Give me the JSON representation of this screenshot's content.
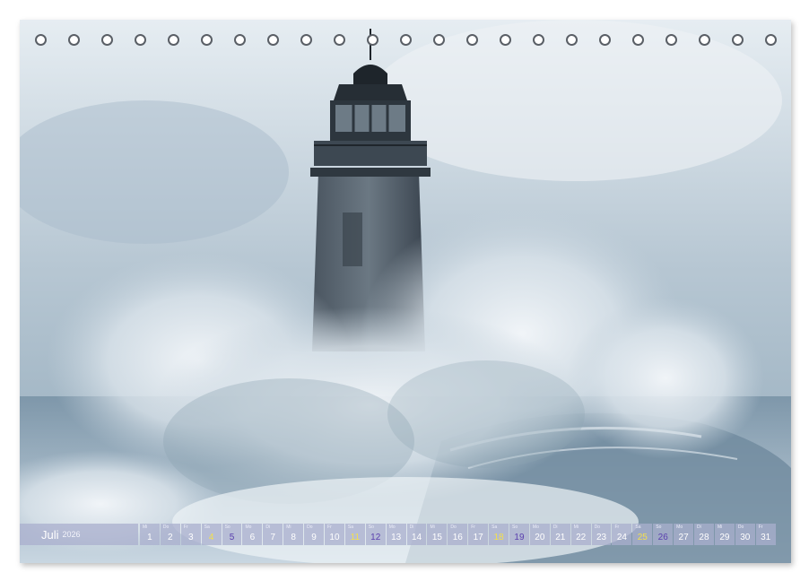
{
  "calendar": {
    "month": "Juli",
    "year": "2026",
    "days": [
      {
        "n": "1",
        "wd": "Mi",
        "type": "weekday"
      },
      {
        "n": "2",
        "wd": "Do",
        "type": "weekday"
      },
      {
        "n": "3",
        "wd": "Fr",
        "type": "weekday"
      },
      {
        "n": "4",
        "wd": "Sa",
        "type": "sat"
      },
      {
        "n": "5",
        "wd": "So",
        "type": "sun"
      },
      {
        "n": "6",
        "wd": "Mo",
        "type": "weekday"
      },
      {
        "n": "7",
        "wd": "Di",
        "type": "weekday"
      },
      {
        "n": "8",
        "wd": "Mi",
        "type": "weekday"
      },
      {
        "n": "9",
        "wd": "Do",
        "type": "weekday"
      },
      {
        "n": "10",
        "wd": "Fr",
        "type": "weekday"
      },
      {
        "n": "11",
        "wd": "Sa",
        "type": "sat"
      },
      {
        "n": "12",
        "wd": "So",
        "type": "sun"
      },
      {
        "n": "13",
        "wd": "Mo",
        "type": "weekday"
      },
      {
        "n": "14",
        "wd": "Di",
        "type": "weekday"
      },
      {
        "n": "15",
        "wd": "Mi",
        "type": "weekday"
      },
      {
        "n": "16",
        "wd": "Do",
        "type": "weekday"
      },
      {
        "n": "17",
        "wd": "Fr",
        "type": "weekday"
      },
      {
        "n": "18",
        "wd": "Sa",
        "type": "sat"
      },
      {
        "n": "19",
        "wd": "So",
        "type": "sun"
      },
      {
        "n": "20",
        "wd": "Mo",
        "type": "weekday"
      },
      {
        "n": "21",
        "wd": "Di",
        "type": "weekday"
      },
      {
        "n": "22",
        "wd": "Mi",
        "type": "weekday"
      },
      {
        "n": "23",
        "wd": "Do",
        "type": "weekday"
      },
      {
        "n": "24",
        "wd": "Fr",
        "type": "weekday"
      },
      {
        "n": "25",
        "wd": "Sa",
        "type": "sat"
      },
      {
        "n": "26",
        "wd": "So",
        "type": "sun"
      },
      {
        "n": "27",
        "wd": "Mo",
        "type": "weekday"
      },
      {
        "n": "28",
        "wd": "Di",
        "type": "weekday"
      },
      {
        "n": "29",
        "wd": "Mi",
        "type": "weekday"
      },
      {
        "n": "30",
        "wd": "Do",
        "type": "weekday"
      },
      {
        "n": "31",
        "wd": "Fr",
        "type": "weekday"
      }
    ]
  },
  "colors": {
    "strip": "#aaafcd",
    "saturday": "#f3e04d",
    "sunday": "#5a3fae"
  },
  "binding_holes": 23
}
